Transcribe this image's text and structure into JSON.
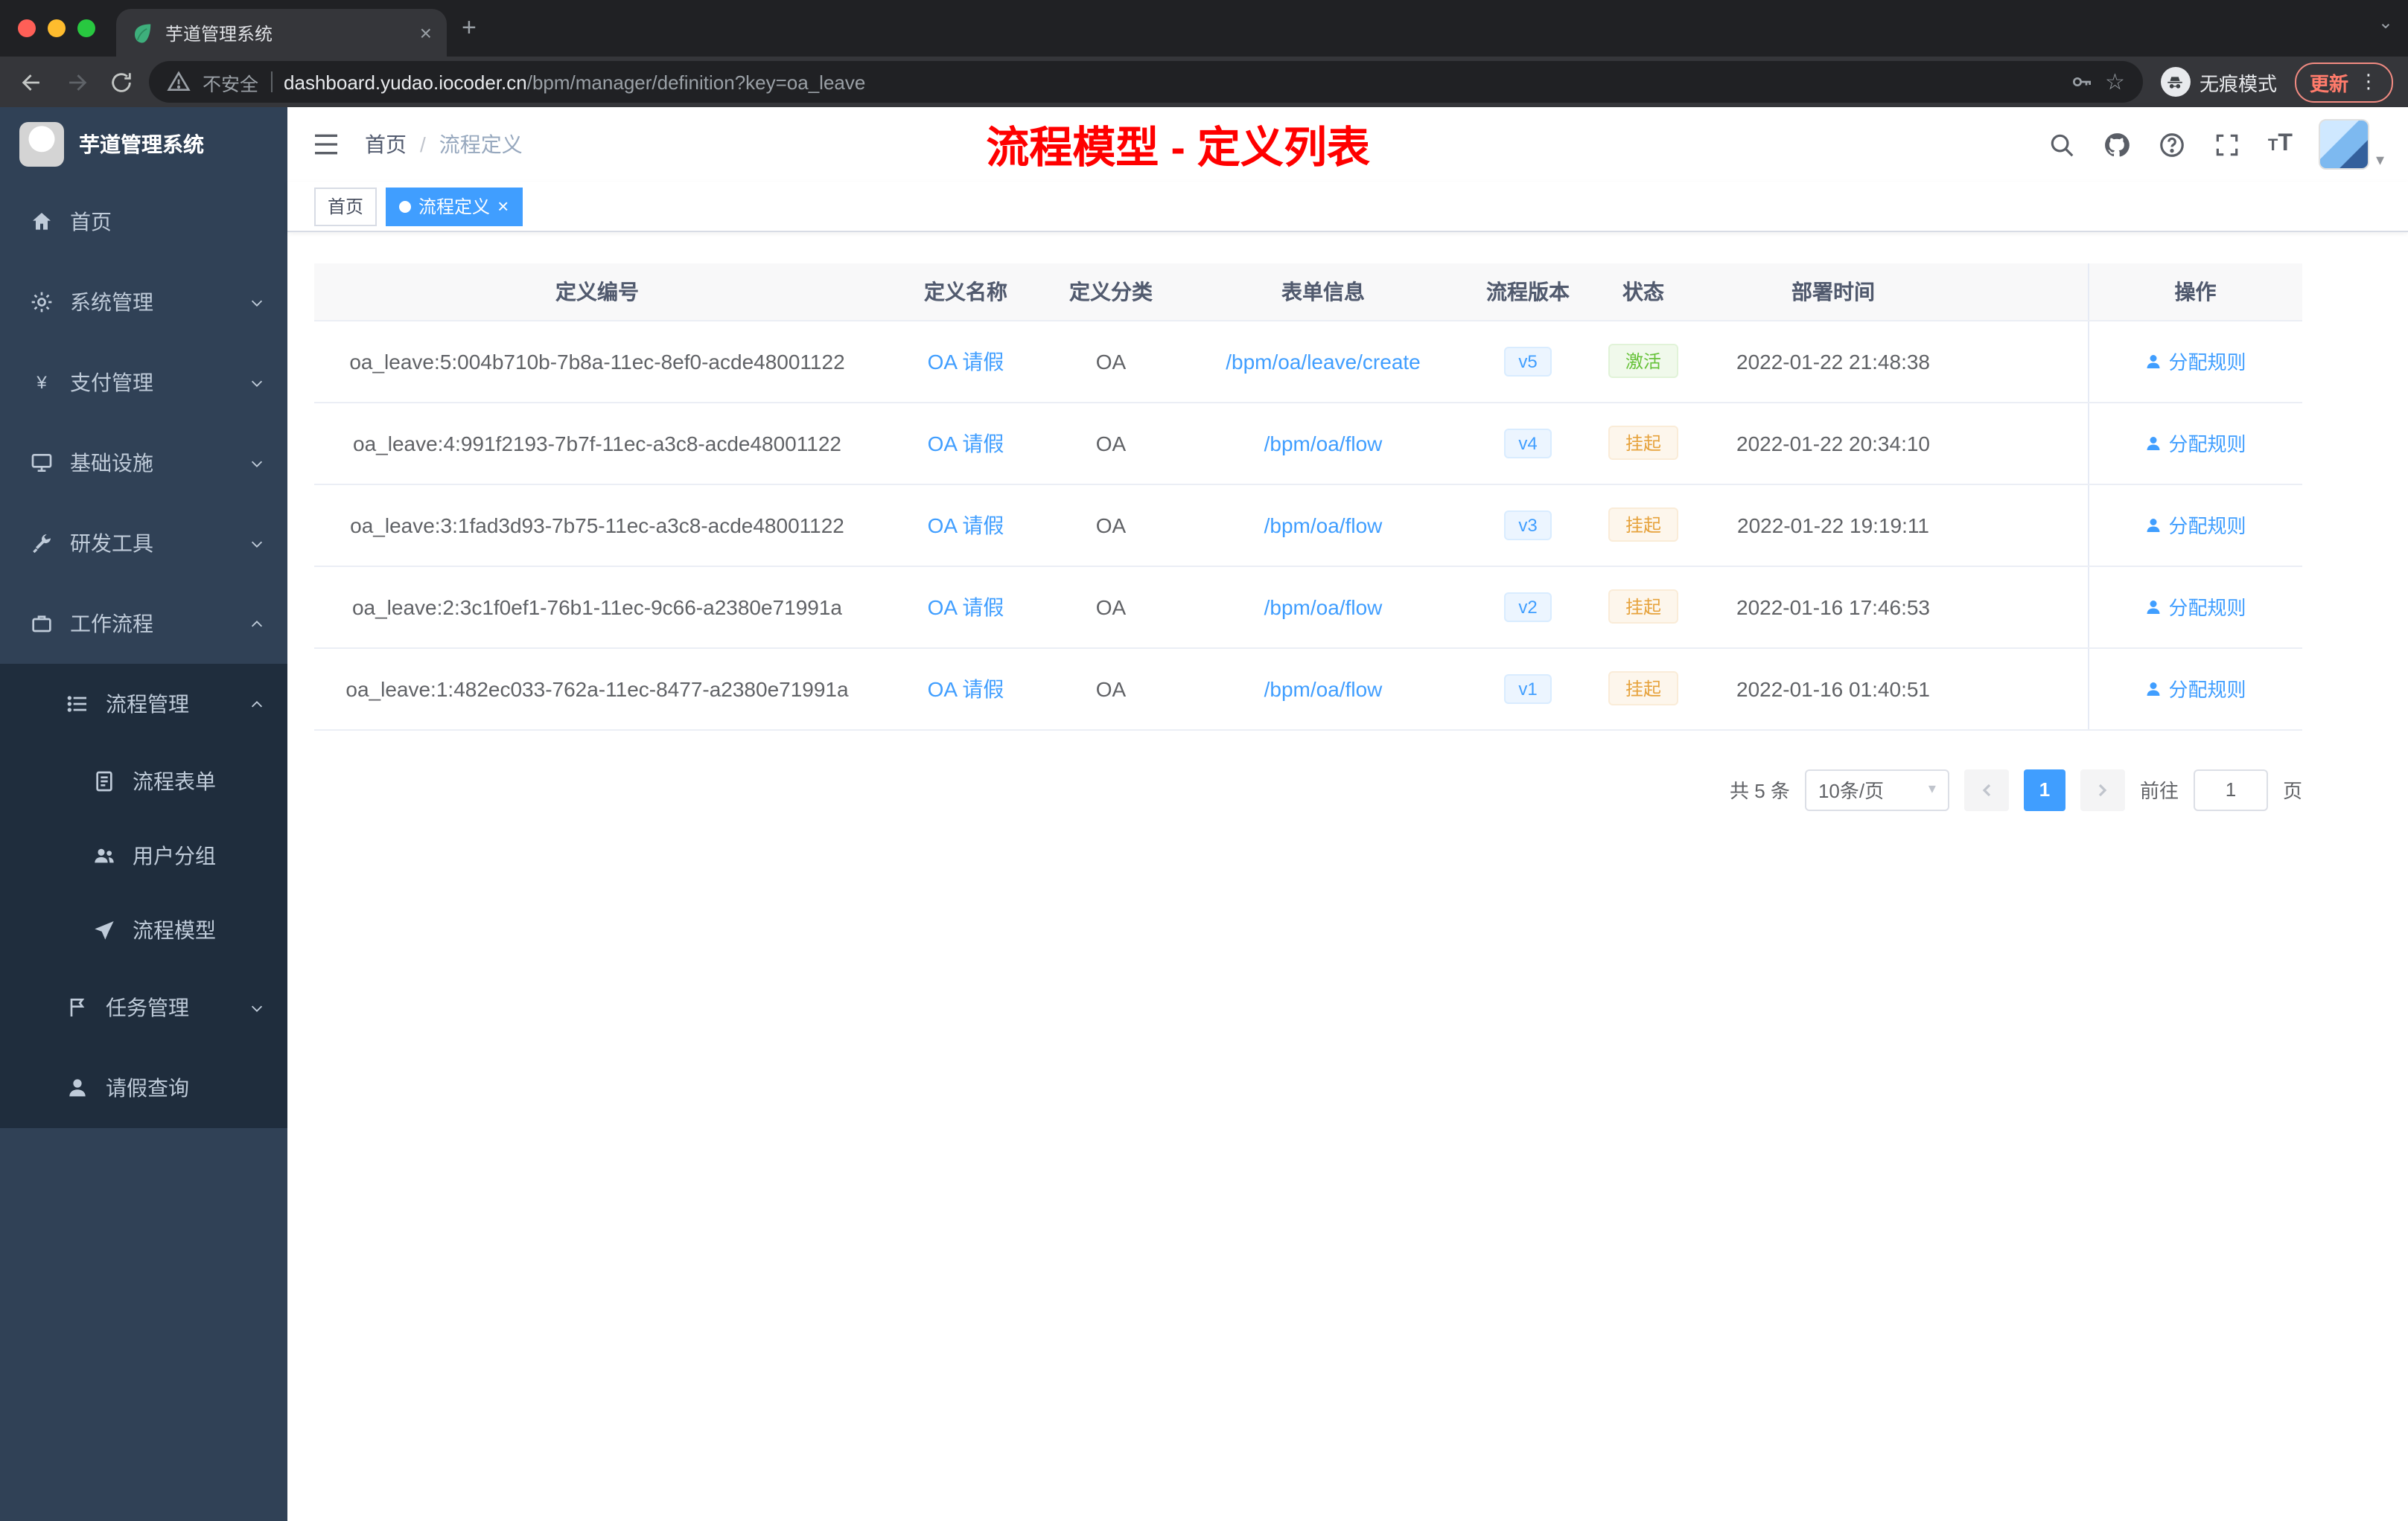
{
  "colors": {
    "accent": "#409eff",
    "title_red": "#ff0000",
    "success": "#67c23a",
    "warning": "#e6a23c",
    "sidebar_bg": "#304156",
    "submenu_bg": "#1f2d3d"
  },
  "icons": {
    "close": "×",
    "new_tab": "+",
    "strip_chevron": "⌄",
    "star": "☆",
    "menu_dots": "⋮",
    "avatar_caret": "▾",
    "select_caret": "▾",
    "tag_close": "×",
    "size_small": "T",
    "size_big": "T"
  },
  "browser": {
    "tab_title": "芋道管理系统",
    "security_label": "不安全",
    "url_domain": "dashboard.yudao.iocoder.cn",
    "url_path": "/bpm/manager/definition?key=oa_leave",
    "incognito_label": "无痕模式",
    "update_label": "更新"
  },
  "sidebar": {
    "app_title": "芋道管理系统",
    "items": [
      {
        "label": "首页"
      },
      {
        "label": "系统管理"
      },
      {
        "label": "支付管理"
      },
      {
        "label": "基础设施"
      },
      {
        "label": "研发工具"
      },
      {
        "label": "工作流程"
      }
    ],
    "workflow_children": {
      "process_manage": "流程管理",
      "process_form": "流程表单",
      "user_group": "用户分组",
      "process_model": "流程模型",
      "task_manage": "任务管理",
      "leave_query": "请假查询"
    }
  },
  "header": {
    "breadcrumb_home": "首页",
    "breadcrumb_separator": "/",
    "breadcrumb_current": "流程定义",
    "page_title": "流程模型 - 定义列表"
  },
  "tags": {
    "home": "首页",
    "active": "流程定义"
  },
  "table": {
    "columns": [
      "定义编号",
      "定义名称",
      "定义分类",
      "表单信息",
      "流程版本",
      "状态",
      "部署时间",
      "操作"
    ],
    "rows": [
      {
        "id": "oa_leave:5:004b710b-7b8a-11ec-8ef0-acde48001122",
        "name": "OA 请假",
        "category": "OA",
        "form": "/bpm/oa/leave/create",
        "version": "v5",
        "status": "激活",
        "status_type": "success",
        "deploy_time": "2022-01-22 21:48:38",
        "action": "分配规则"
      },
      {
        "id": "oa_leave:4:991f2193-7b7f-11ec-a3c8-acde48001122",
        "name": "OA 请假",
        "category": "OA",
        "form": "/bpm/oa/flow",
        "version": "v4",
        "status": "挂起",
        "status_type": "warning",
        "deploy_time": "2022-01-22 20:34:10",
        "action": "分配规则"
      },
      {
        "id": "oa_leave:3:1fad3d93-7b75-11ec-a3c8-acde48001122",
        "name": "OA 请假",
        "category": "OA",
        "form": "/bpm/oa/flow",
        "version": "v3",
        "status": "挂起",
        "status_type": "warning",
        "deploy_time": "2022-01-22 19:19:11",
        "action": "分配规则"
      },
      {
        "id": "oa_leave:2:3c1f0ef1-76b1-11ec-9c66-a2380e71991a",
        "name": "OA 请假",
        "category": "OA",
        "form": "/bpm/oa/flow",
        "version": "v2",
        "status": "挂起",
        "status_type": "warning",
        "deploy_time": "2022-01-16 17:46:53",
        "action": "分配规则"
      },
      {
        "id": "oa_leave:1:482ec033-762a-11ec-8477-a2380e71991a",
        "name": "OA 请假",
        "category": "OA",
        "form": "/bpm/oa/flow",
        "version": "v1",
        "status": "挂起",
        "status_type": "warning",
        "deploy_time": "2022-01-16 01:40:51",
        "action": "分配规则"
      }
    ]
  },
  "pagination": {
    "total": "共 5 条",
    "page_size": "10条/页",
    "current_page": "1",
    "goto_label": "前往",
    "goto_value": "1",
    "page_unit": "页"
  }
}
